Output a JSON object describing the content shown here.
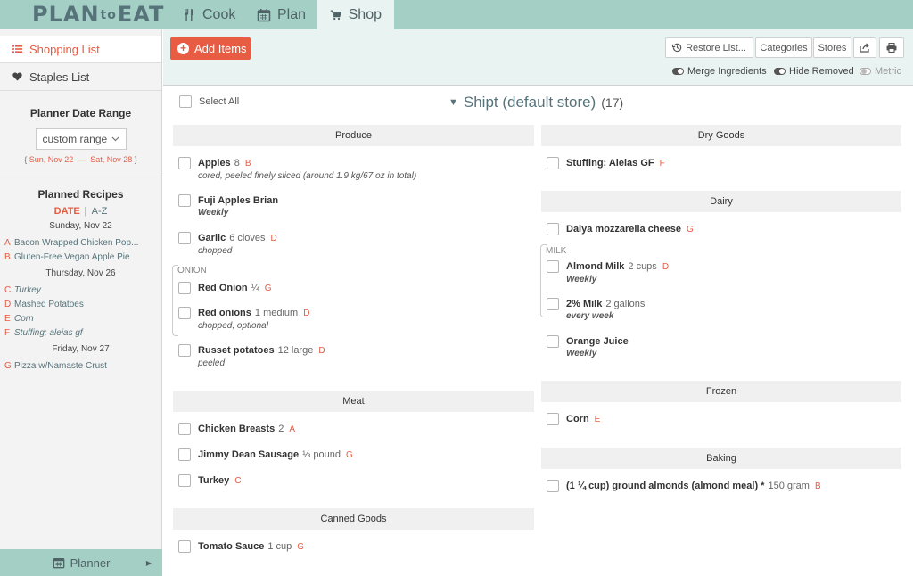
{
  "app": {
    "logo": "PLAN",
    "logo_amp": "to",
    "logo_end": "EAT"
  },
  "nav": {
    "cook": "Cook",
    "plan": "Plan",
    "shop": "Shop"
  },
  "sidebar": {
    "shopping_list": "Shopping List",
    "staples_list": "Staples List",
    "date_range_title": "Planner Date Range",
    "range_select": "custom range",
    "range_start": "Sun, Nov 22",
    "range_sep": "—",
    "range_end": "Sat, Nov 28",
    "planned_title": "Planned Recipes",
    "sort_date": "DATE",
    "sort_sep": "|",
    "sort_az": "A-Z",
    "days": [
      {
        "label": "Sunday, Nov 22",
        "recipes": [
          {
            "letter": "A",
            "name": "Bacon Wrapped Chicken Pop...",
            "italic": false
          },
          {
            "letter": "B",
            "name": "Gluten-Free Vegan Apple Pie",
            "italic": false
          }
        ]
      },
      {
        "label": "Thursday, Nov 26",
        "recipes": [
          {
            "letter": "C",
            "name": "Turkey",
            "italic": true
          },
          {
            "letter": "D",
            "name": "Mashed Potatoes",
            "italic": false
          },
          {
            "letter": "E",
            "name": "Corn",
            "italic": true
          },
          {
            "letter": "F",
            "name": "Stuffing: aleias gf",
            "italic": true
          }
        ]
      },
      {
        "label": "Friday, Nov 27",
        "recipes": [
          {
            "letter": "G",
            "name": "Pizza w/Namaste Crust",
            "italic": false
          }
        ]
      }
    ],
    "planner": "Planner"
  },
  "toolbar": {
    "add_items": "Add Items",
    "restore": "Restore List...",
    "categories": "Categories",
    "stores": "Stores",
    "merge": "Merge Ingredients",
    "hide_removed": "Hide Removed",
    "metric": "Metric"
  },
  "main": {
    "select_all": "Select All",
    "store": "Shipt (default store)",
    "store_count": "(17)",
    "categories": {
      "produce": "Produce",
      "meat": "Meat",
      "canned": "Canned Goods",
      "dry": "Dry Goods",
      "dairy": "Dairy",
      "frozen": "Frozen",
      "baking": "Baking"
    },
    "group_onion": "ONION",
    "group_milk": "MILK",
    "items": {
      "apples": {
        "name": "Apples",
        "qty": "8",
        "letter": "B",
        "note": "cored, peeled finely sliced (around 1.9 kg/67 oz in total)"
      },
      "fuji": {
        "name": "Fuji Apples Brian",
        "qty": "",
        "letter": "",
        "note": "Weekly"
      },
      "garlic": {
        "name": "Garlic",
        "qty": "6 cloves",
        "letter": "D",
        "note": "chopped"
      },
      "red_onion": {
        "name": "Red Onion",
        "qty": "¼",
        "letter": "G",
        "note": ""
      },
      "red_onions": {
        "name": "Red onions",
        "qty": "1 medium",
        "letter": "D",
        "note": "chopped, optional"
      },
      "russet": {
        "name": "Russet potatoes",
        "qty": "12 large",
        "letter": "D",
        "note": "peeled"
      },
      "chicken": {
        "name": "Chicken Breasts",
        "qty": "2",
        "letter": "A",
        "note": ""
      },
      "sausage": {
        "name": "Jimmy Dean Sausage",
        "qty": "⅓ pound",
        "letter": "G",
        "note": ""
      },
      "turkey": {
        "name": "Turkey",
        "qty": "",
        "letter": "C",
        "note": ""
      },
      "tomato": {
        "name": "Tomato Sauce",
        "qty": "1 cup",
        "letter": "G",
        "note": ""
      },
      "stuffing": {
        "name": "Stuffing: Aleias GF",
        "qty": "",
        "letter": "F",
        "note": ""
      },
      "daiya": {
        "name": "Daiya mozzarella cheese",
        "qty": "",
        "letter": "G",
        "note": ""
      },
      "almond_milk": {
        "name": "Almond Milk",
        "qty": "2 cups",
        "letter": "D",
        "note": "Weekly"
      },
      "milk2": {
        "name": "2% Milk",
        "qty": "2 gallons",
        "letter": "",
        "note": "every week"
      },
      "oj": {
        "name": "Orange Juice",
        "qty": "",
        "letter": "",
        "note": "Weekly"
      },
      "corn": {
        "name": "Corn",
        "qty": "",
        "letter": "E",
        "note": ""
      },
      "almonds": {
        "name": "(1 ¼ cup) ground almonds (almond meal) *",
        "qty": "150 gram",
        "letter": "B",
        "note": ""
      }
    }
  },
  "colors": {
    "accent": "#e85c43",
    "topbar": "#a4cfc5",
    "teal_text": "#56737a"
  }
}
